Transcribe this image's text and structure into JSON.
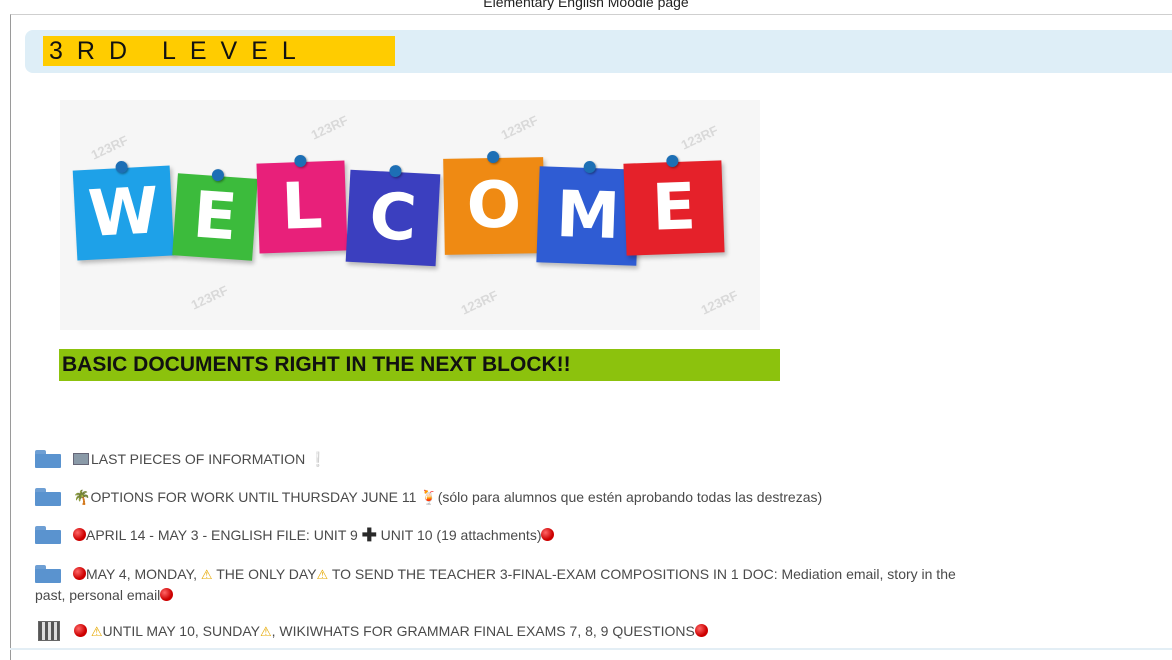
{
  "document_caption": "Elementary English Moodle page",
  "section": {
    "title": "3RD LEVEL",
    "highlight_color": "#ffcc00",
    "header_bg": "#deeef7"
  },
  "banner": {
    "letters": [
      "W",
      "E",
      "L",
      "C",
      "O",
      "M",
      "E"
    ],
    "tile_colors": [
      "#1ea1e8",
      "#3cbb3c",
      "#e8207a",
      "#3b3fbf",
      "#ef8a13",
      "#2f5cd3",
      "#e5212a"
    ],
    "watermark": "123RF"
  },
  "notice": {
    "text": "BASIC DOCUMENTS RIGHT IN THE NEXT BLOCK!!",
    "highlight_color": "#8cc20d"
  },
  "activities": [
    {
      "type": "folder",
      "icon": "folder-icon",
      "text": "LAST PIECES OF INFORMATION"
    },
    {
      "type": "folder",
      "icon": "folder-icon",
      "text": "OPTIONS FOR WORK UNTIL THURSDAY JUNE 11",
      "note": "(sólo para alumnos que estén aprobando todas las destrezas)"
    },
    {
      "type": "folder",
      "icon": "folder-icon",
      "text_a": "APRIL 14 - MAY 3 - ENGLISH FILE: UNIT 9",
      "text_b": "UNIT 10 (19 attachments)"
    },
    {
      "type": "folder",
      "icon": "folder-icon",
      "text_a": "MAY 4, MONDAY,",
      "text_b": "THE ONLY DAY",
      "text_c": "TO SEND THE TEACHER 3-FINAL-EXAM COMPOSITIONS IN 1 DOC: Mediation email, story in the",
      "text_d": "past, personal email"
    },
    {
      "type": "wiki",
      "icon": "wiki-icon",
      "text_a": "UNTIL MAY 10, SUNDAY",
      "text_b": ", WIKIWHATS FOR GRAMMAR FINAL EXAMS 7, 8, 9 QUESTIONS"
    }
  ]
}
